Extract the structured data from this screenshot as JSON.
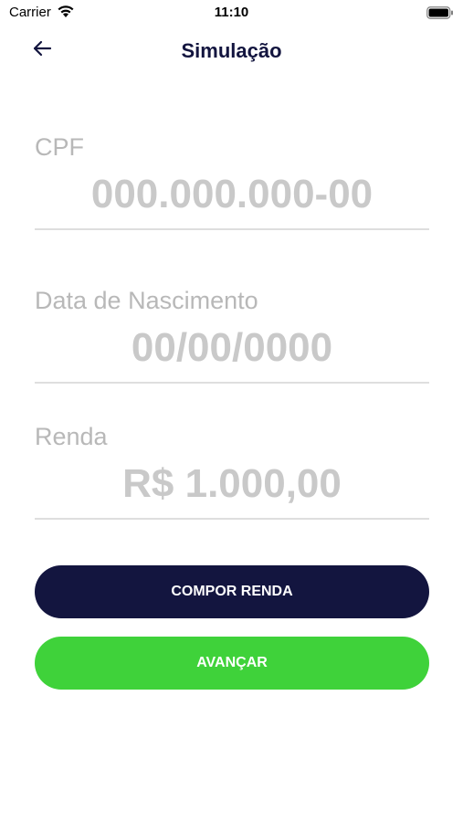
{
  "status_bar": {
    "carrier": "Carrier",
    "time": "11:10",
    "icons": [
      "wifi-icon",
      "battery-icon"
    ]
  },
  "nav": {
    "title": "Simulação",
    "back_icon": "arrow-left-icon"
  },
  "form": {
    "cpf": {
      "label": "CPF",
      "placeholder": "000.000.000-00",
      "value": ""
    },
    "nascimento": {
      "label": "Data de Nascimento",
      "placeholder": "00/00/0000",
      "value": ""
    },
    "renda": {
      "label": "Renda",
      "placeholder": "R$ 1.000,00",
      "value": ""
    }
  },
  "buttons": {
    "compor_renda": "COMPOR RENDA",
    "avancar": "AVANÇAR"
  },
  "colors": {
    "primary_dark": "#13153f",
    "accent_green": "#3fd23a",
    "label_gray": "#b8b8b8",
    "placeholder_gray": "#c9c9c9",
    "divider": "#dedede"
  }
}
